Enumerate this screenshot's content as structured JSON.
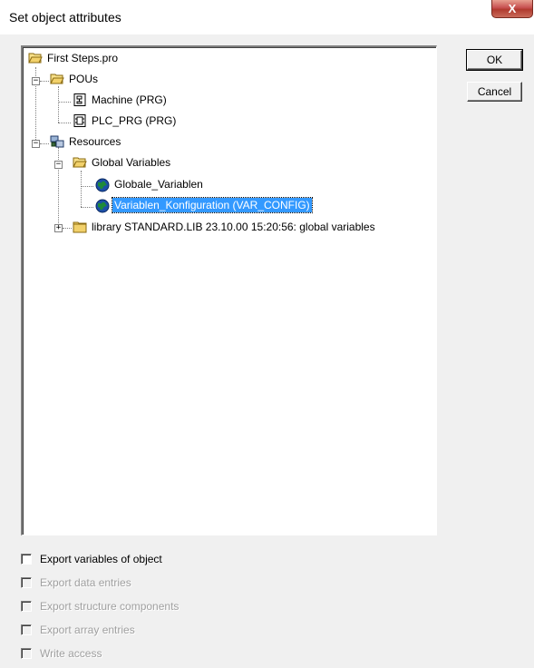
{
  "window": {
    "title": "Set object attributes",
    "close_label": "X"
  },
  "tree": {
    "items": [
      {
        "label": "First Steps.pro",
        "icon": "folder-open-icon"
      },
      {
        "label": "POUs",
        "icon": "folder-open-icon"
      },
      {
        "label": "Machine (PRG)",
        "icon": "sfc-program-icon"
      },
      {
        "label": "PLC_PRG (PRG)",
        "icon": "st-program-icon"
      },
      {
        "label": "Resources",
        "icon": "resources-icon"
      },
      {
        "label": "Global Variables",
        "icon": "folder-open-icon"
      },
      {
        "label": "Globale_Variablen",
        "icon": "globe-icon"
      },
      {
        "label": "Variablen_Konfiguration (VAR_CONFIG)",
        "icon": "globe-icon",
        "selected": true
      },
      {
        "label": "library STANDARD.LIB 23.10.00 15:20:56: global variables",
        "icon": "folder-closed-icon"
      }
    ]
  },
  "buttons": {
    "ok": "OK",
    "cancel": "Cancel"
  },
  "options": [
    {
      "label": "Export variables of object",
      "enabled": true,
      "checked": false
    },
    {
      "label": "Export data entries",
      "enabled": false,
      "checked": false
    },
    {
      "label": "Export structure components",
      "enabled": false,
      "checked": false
    },
    {
      "label": "Export array entries",
      "enabled": false,
      "checked": false
    },
    {
      "label": "Write access",
      "enabled": false,
      "checked": false
    }
  ],
  "colors": {
    "selection": "#3399ff",
    "close_button": "#c75050",
    "folder": "#f2d16b",
    "globe": "#1f8a3a"
  }
}
